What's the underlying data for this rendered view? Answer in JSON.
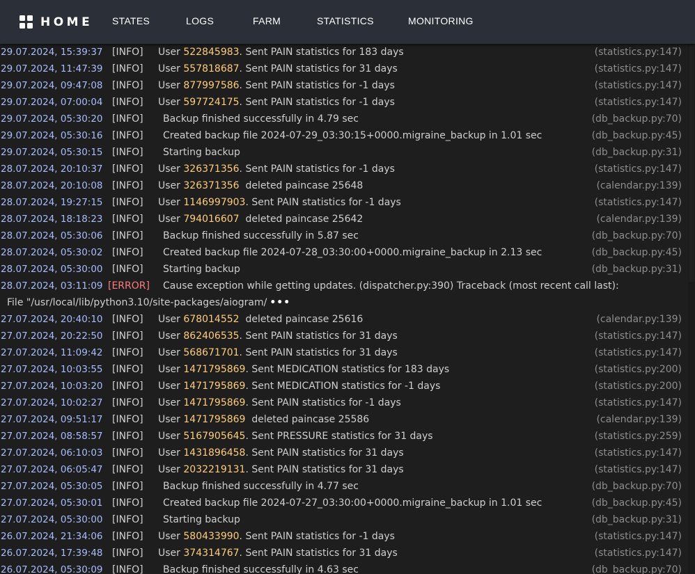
{
  "nav": {
    "brand": "HOME",
    "items": [
      "STATES",
      "LOGS",
      "FARM",
      "STATISTICS",
      "MONITORING"
    ]
  },
  "colors": {
    "nav_bg": "#2a2f38",
    "page_bg": "#1e1e1e",
    "timestamp": "#a9bcff",
    "user_id": "#ffcc7a",
    "error": "#ff7b7b",
    "source": "#8d8d8d"
  },
  "icons": {
    "brand": "grid-icon",
    "more": "ellipsis-icon"
  },
  "logs": [
    {
      "ts": "29.07.2024, 15:39:37",
      "level": "[INFO]",
      "user": "522845983",
      "msg": ". Sent PAIN statistics for 183 days",
      "src": "(statistics.py:147)"
    },
    {
      "ts": "29.07.2024, 11:47:39",
      "level": "[INFO]",
      "user": "557818687",
      "msg": ". Sent PAIN statistics for 31 days",
      "src": "(statistics.py:147)"
    },
    {
      "ts": "29.07.2024, 09:47:08",
      "level": "[INFO]",
      "user": "877997586",
      "msg": ". Sent PAIN statistics for -1 days",
      "src": "(statistics.py:147)"
    },
    {
      "ts": "29.07.2024, 07:00:04",
      "level": "[INFO]",
      "user": "597724175",
      "msg": ". Sent PAIN statistics for -1 days",
      "src": "(statistics.py:147)"
    },
    {
      "ts": "29.07.2024, 05:30:20",
      "level": "[INFO]",
      "msg": "Backup finished successfully in 4.79 sec",
      "src": "(db_backup.py:70)"
    },
    {
      "ts": "29.07.2024, 05:30:16",
      "level": "[INFO]",
      "msg": "Created backup file 2024-07-29_03:30:15+0000.migraine_backup in 1.01 sec",
      "src": "(db_backup.py:45)"
    },
    {
      "ts": "29.07.2024, 05:30:15",
      "level": "[INFO]",
      "msg": "Starting backup",
      "src": "(db_backup.py:31)"
    },
    {
      "ts": "28.07.2024, 20:10:37",
      "level": "[INFO]",
      "user": "326371356",
      "msg": ". Sent PAIN statistics for -1 days",
      "src": "(statistics.py:147)"
    },
    {
      "ts": "28.07.2024, 20:10:08",
      "level": "[INFO]",
      "user": "326371356",
      "msg": "  deleted paincase 25648",
      "src": "(calendar.py:139)"
    },
    {
      "ts": "28.07.2024, 19:27:15",
      "level": "[INFO]",
      "user": "1146997903",
      "msg": ". Sent PAIN statistics for -1 days",
      "src": "(statistics.py:147)"
    },
    {
      "ts": "28.07.2024, 18:18:23",
      "level": "[INFO]",
      "user": "794016607",
      "msg": "  deleted paincase 25642",
      "src": "(calendar.py:139)"
    },
    {
      "ts": "28.07.2024, 05:30:06",
      "level": "[INFO]",
      "msg": "Backup finished successfully in 5.87 sec",
      "src": "(db_backup.py:70)"
    },
    {
      "ts": "28.07.2024, 05:30:02",
      "level": "[INFO]",
      "msg": "Created backup file 2024-07-28_03:30:00+0000.migraine_backup in 2.13 sec",
      "src": "(db_backup.py:45)"
    },
    {
      "ts": "28.07.2024, 05:30:00",
      "level": "[INFO]",
      "msg": "Starting backup",
      "src": "(db_backup.py:31)"
    },
    {
      "ts": "28.07.2024, 03:11:09",
      "level": "[ERROR]",
      "msg": "Cause exception while getting updates. (dispatcher.py:390)  Traceback (most recent call last):",
      "src": "",
      "continuation": "File \"/usr/local/lib/python3.10/site-packages/aiogram/",
      "more": "•••"
    },
    {
      "ts": "27.07.2024, 20:40:10",
      "level": "[INFO]",
      "user": "678014552",
      "msg": "  deleted paincase 25616",
      "src": "(calendar.py:139)"
    },
    {
      "ts": "27.07.2024, 20:22:50",
      "level": "[INFO]",
      "user": "862406535",
      "msg": ". Sent PAIN statistics for 31 days",
      "src": "(statistics.py:147)"
    },
    {
      "ts": "27.07.2024, 11:09:42",
      "level": "[INFO]",
      "user": "568671701",
      "msg": ". Sent PAIN statistics for 31 days",
      "src": "(statistics.py:147)"
    },
    {
      "ts": "27.07.2024, 10:03:55",
      "level": "[INFO]",
      "user": "1471795869",
      "msg": ". Sent MEDICATION statistics for 183 days",
      "src": "(statistics.py:200)"
    },
    {
      "ts": "27.07.2024, 10:03:20",
      "level": "[INFO]",
      "user": "1471795869",
      "msg": ". Sent MEDICATION statistics for -1 days",
      "src": "(statistics.py:200)"
    },
    {
      "ts": "27.07.2024, 10:02:27",
      "level": "[INFO]",
      "user": "1471795869",
      "msg": ". Sent PAIN statistics for -1 days",
      "src": "(statistics.py:147)"
    },
    {
      "ts": "27.07.2024, 09:51:17",
      "level": "[INFO]",
      "user": "1471795869",
      "msg": "  deleted paincase 25586",
      "src": "(calendar.py:139)"
    },
    {
      "ts": "27.07.2024, 08:58:57",
      "level": "[INFO]",
      "user": "5167905645",
      "msg": ". Sent PRESSURE statistics for 31 days",
      "src": "(statistics.py:259)"
    },
    {
      "ts": "27.07.2024, 06:10:03",
      "level": "[INFO]",
      "user": "1431896458",
      "msg": ". Sent PAIN statistics for 31 days",
      "src": "(statistics.py:147)"
    },
    {
      "ts": "27.07.2024, 06:05:47",
      "level": "[INFO]",
      "user": "2032219131",
      "msg": ". Sent PAIN statistics for 31 days",
      "src": "(statistics.py:147)"
    },
    {
      "ts": "27.07.2024, 05:30:05",
      "level": "[INFO]",
      "msg": "Backup finished successfully in 4.77 sec",
      "src": "(db_backup.py:70)"
    },
    {
      "ts": "27.07.2024, 05:30:01",
      "level": "[INFO]",
      "msg": "Created backup file 2024-07-27_03:30:00+0000.migraine_backup in 1.01 sec",
      "src": "(db_backup.py:45)"
    },
    {
      "ts": "27.07.2024, 05:30:00",
      "level": "[INFO]",
      "msg": "Starting backup",
      "src": "(db_backup.py:31)"
    },
    {
      "ts": "26.07.2024, 21:34:06",
      "level": "[INFO]",
      "user": "580433990",
      "msg": ". Sent PAIN statistics for -1 days",
      "src": "(statistics.py:147)"
    },
    {
      "ts": "26.07.2024, 17:39:48",
      "level": "[INFO]",
      "user": "374314767",
      "msg": ". Sent PAIN statistics for 31 days",
      "src": "(statistics.py:147)"
    },
    {
      "ts": "26.07.2024, 05:30:09",
      "level": "[INFO]",
      "msg": "Backup finished successfully in 4.63 sec",
      "src": "(db_backup.py:70)"
    }
  ]
}
